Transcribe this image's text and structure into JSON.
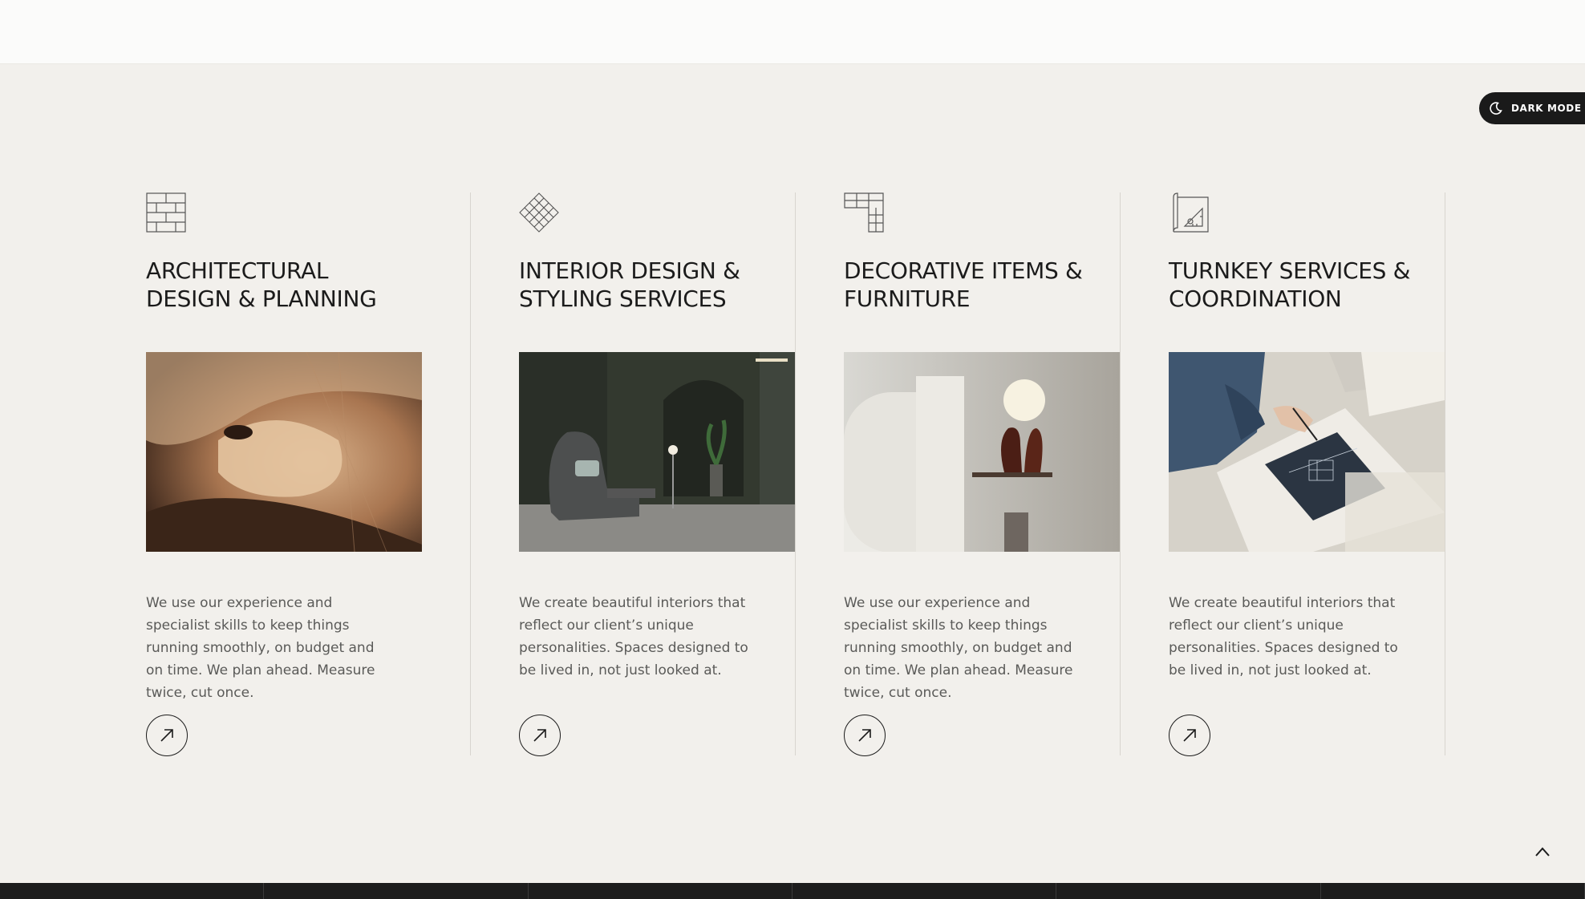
{
  "theme_toggle": {
    "label": "DARK MODE",
    "icon": "moon-icon"
  },
  "colors": {
    "background": "#f2f0ec",
    "text": "#1b1b1b",
    "muted": "#5a5a58",
    "divider": "#d8d5cf"
  },
  "services": [
    {
      "icon": "brick-wall-icon",
      "title": "ARCHITECTURAL DESIGN & PLANNING",
      "image": "spiral-staircase-photo",
      "description": "We use our experience and specialist skills to keep things running smoothly, on budget and on time. We plan ahead. Measure twice, cut once.",
      "link_icon": "arrow-up-right-icon"
    },
    {
      "icon": "diamond-lattice-icon",
      "title": "INTERIOR DESIGN & STYLING SERVICES",
      "image": "lounge-chair-interior-photo",
      "description": "We create beautiful interiors that reflect our client’s unique personalities. Spaces designed to be lived in, not just looked at.",
      "link_icon": "arrow-up-right-icon"
    },
    {
      "icon": "furniture-blocks-icon",
      "title": "DECORATIVE ITEMS & FURNITURE",
      "image": "sculptural-lamp-photo",
      "description": "We use our experience and specialist skills to keep things running smoothly, on budget and on time. We plan ahead. Measure twice, cut once.",
      "link_icon": "arrow-up-right-icon"
    },
    {
      "icon": "blueprint-ruler-icon",
      "title": "TURNKEY SERVICES & COORDINATION",
      "image": "blueprint-drafting-photo",
      "description": "We create beautiful interiors that reflect our client’s unique personalities. Spaces designed to be lived in, not just looked at.",
      "link_icon": "arrow-up-right-icon"
    }
  ],
  "scroll_top": {
    "icon": "chevron-up-icon"
  }
}
